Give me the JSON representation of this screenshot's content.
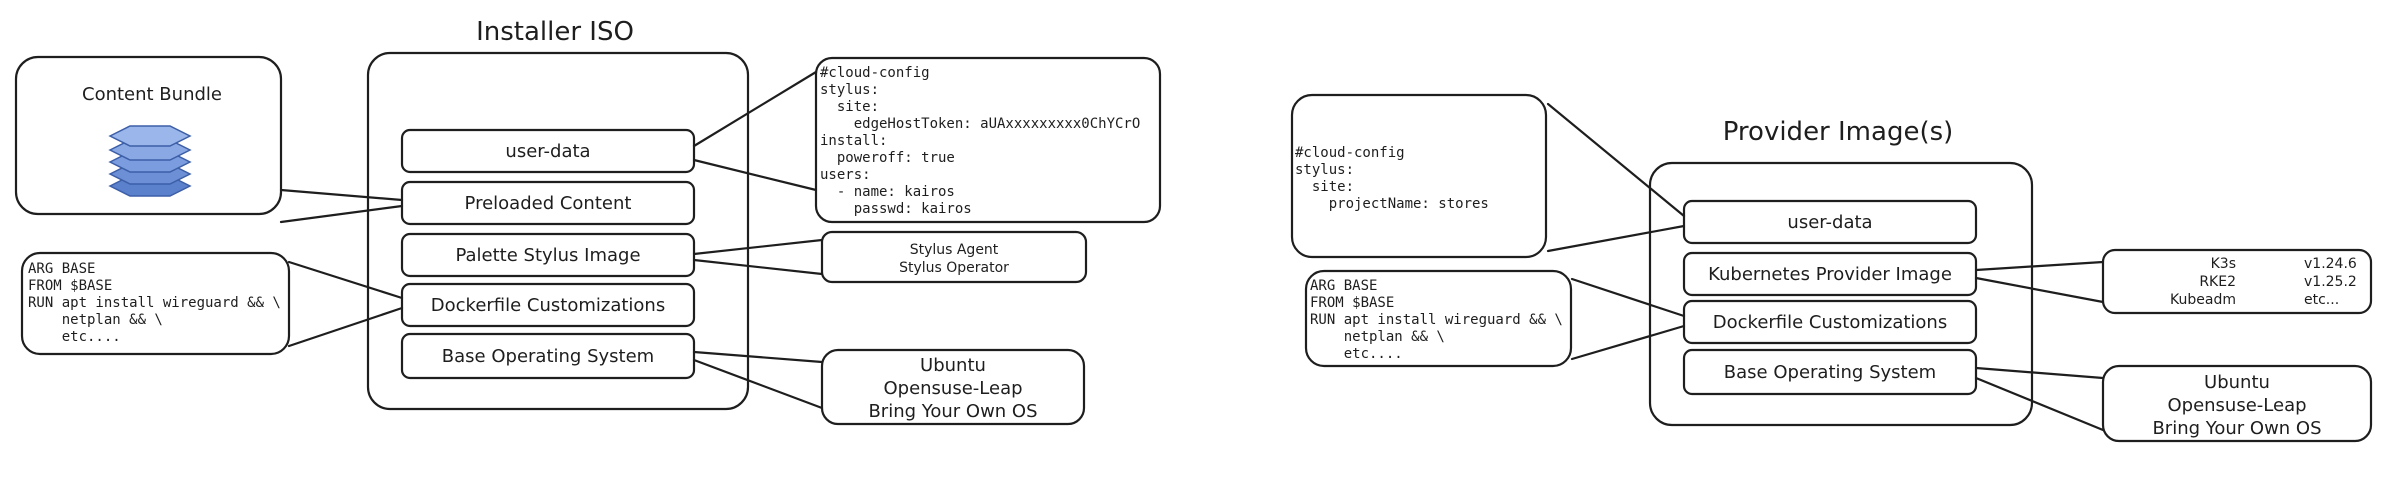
{
  "installer": {
    "title": "Installer ISO",
    "content_bundle": {
      "label": "Content Bundle"
    },
    "layers": [
      {
        "label": "user-data",
        "color": "#e7ddd6"
      },
      {
        "label": "Preloaded Content",
        "color": "#fbc7d9"
      },
      {
        "label": "Palette Stylus Image",
        "color": "#fde68a"
      },
      {
        "label": "Dockerfile Customizations",
        "color": "#b4f2bc"
      },
      {
        "label": "Base Operating System",
        "color": "#a5d8ff"
      }
    ],
    "cloud_config": [
      "#cloud-config",
      "stylus:",
      "  site:",
      "    edgeHostToken: aUAxxxxxxxxx0ChYCrO",
      "install:",
      "  poweroff: true",
      "users:",
      "  - name: kairos",
      "    passwd: kairos"
    ],
    "dockerfile": [
      "ARG BASE",
      "FROM $BASE",
      "RUN apt install wireguard && \\",
      "    netplan && \\",
      "    etc...."
    ],
    "stylus_note": [
      "Stylus Agent",
      "Stylus Operator"
    ],
    "os_note": [
      "Ubuntu",
      "Opensuse-Leap",
      "Bring Your Own OS"
    ]
  },
  "provider": {
    "title": "Provider Image(s)",
    "layers": [
      {
        "label": "user-data",
        "color": "#e7ddd6"
      },
      {
        "label": "Kubernetes Provider Image",
        "color": "#fde68a"
      },
      {
        "label": "Dockerfile Customizations",
        "color": "#b4f2bc"
      },
      {
        "label": "Base Operating System",
        "color": "#a5d8ff"
      }
    ],
    "cloud_config": [
      "#cloud-config",
      "stylus:",
      "  site:",
      "    projectName: stores"
    ],
    "dockerfile": [
      "ARG BASE",
      "FROM $BASE",
      "RUN apt install wireguard && \\",
      "    netplan && \\",
      "    etc...."
    ],
    "k8s_versions": [
      {
        "name": "K3s",
        "version": "v1.24.6"
      },
      {
        "name": "RKE2",
        "version": "v1.25.2"
      },
      {
        "name": "Kubeadm",
        "version": "etc..."
      }
    ],
    "os_note": [
      "Ubuntu",
      "Opensuse-Leap",
      "Bring Your Own OS"
    ]
  },
  "colors": {
    "pink_note": "#fbe3ec",
    "green_note": "#e6f7e8",
    "yellow_note": "#fff5d9",
    "blue_note": "#e3f1fb",
    "gray_note": "#f4f2f0",
    "stack": "#6c8fd6"
  }
}
